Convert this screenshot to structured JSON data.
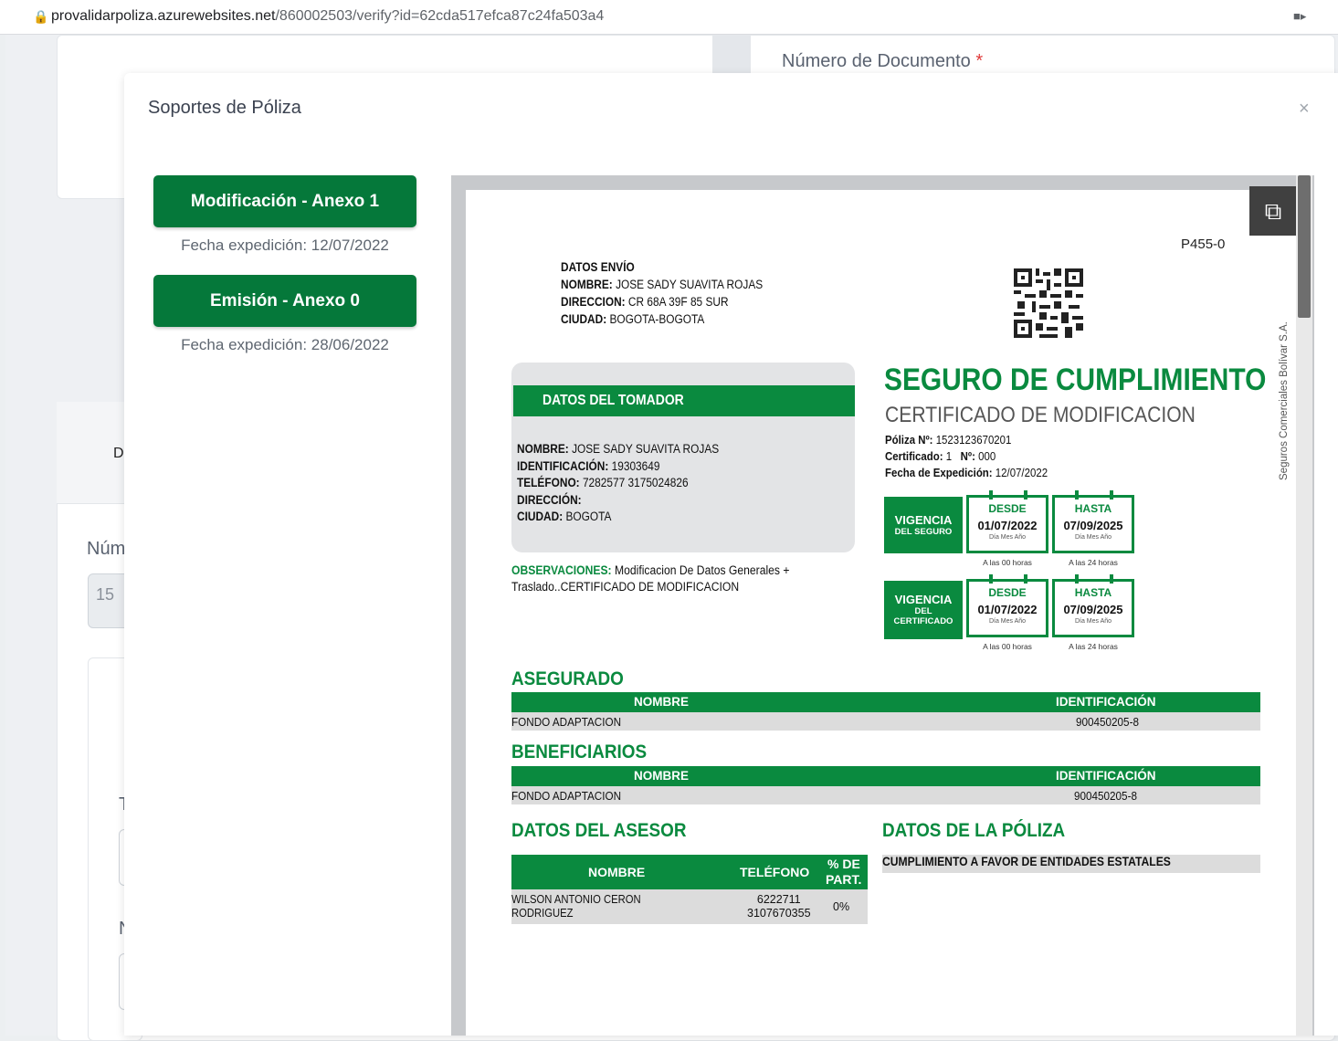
{
  "browser": {
    "url_host": "provalidarpoliza.azurewebsites.net",
    "url_path": "/860002503/verify?id=62cda517efca87c24fa503a4"
  },
  "background": {
    "label_numero_documento": "Número de Documento",
    "required_mark": "*",
    "tab_partial": "D",
    "label_partial_num": "Núm",
    "input_partial_value": "15",
    "label_partial_t": "T",
    "label_partial_n": "N"
  },
  "modal": {
    "title": "Soportes de Póliza",
    "close_label": "×",
    "documents": [
      {
        "label": "Modificación - Anexo 1",
        "date": "Fecha expedición: 12/07/2022"
      },
      {
        "label": "Emisión - Anexo 0",
        "date": "Fecha expedición: 28/06/2022"
      }
    ]
  },
  "document": {
    "code": "P455-0",
    "envio": {
      "title": "DATOS ENVÍO",
      "nombre_label": "NOMBRE:",
      "nombre": "JOSE SADY SUAVITA ROJAS",
      "direccion_label": "DIRECCION:",
      "direccion": "CR 68A 39F 85 SUR",
      "ciudad_label": "CIUDAD:",
      "ciudad": "BOGOTA-BOGOTA"
    },
    "vertical_text": "Seguros Comerciales Bolívar S.A.",
    "tomador": {
      "header": "DATOS DEL TOMADOR",
      "nombre_label": "NOMBRE:",
      "nombre": "JOSE SADY SUAVITA ROJAS",
      "id_label": "IDENTIFICACIÓN:",
      "id": "19303649",
      "tel_label": "TELÉFONO:",
      "tel": "7282577 3175024826",
      "dir_label": "DIRECCIÓN:",
      "ciudad_label": "CIUDAD:",
      "ciudad": "BOGOTA"
    },
    "observaciones_label": "OBSERVACIONES:",
    "observaciones": "Modificacion De Datos Generales + Traslado..CERTIFICADO DE MODIFICACION",
    "title": "SEGURO DE CUMPLIMIENTO",
    "subtitle": "CERTIFICADO DE MODIFICACION",
    "poliza_label": "Póliza Nº:",
    "poliza": "1523123670201",
    "certificado_label": "Certificado:",
    "certificado": "1",
    "no_label": "Nº:",
    "no": "000",
    "fecha_exp_label": "Fecha de Expedición:",
    "fecha_exp": "12/07/2022",
    "vigencia_seguro": {
      "l1": "VIGENCIA",
      "l2": "DEL SEGURO",
      "desde": "01/07/2022",
      "hasta": "07/09/2025"
    },
    "vigencia_cert": {
      "l1": "VIGENCIA",
      "l2": "DEL",
      "l3": "CERTIFICADO",
      "desde": "01/07/2022",
      "hasta": "07/09/2025"
    },
    "desde_label": "DESDE",
    "hasta_label": "HASTA",
    "dma_label": "Día Mes Año",
    "hora_desde": "A las 00 horas",
    "hora_hasta": "A las 24 horas",
    "asegurado_title": "ASEGURADO",
    "beneficiarios_title": "BENEFICIARIOS",
    "col_nombre": "NOMBRE",
    "col_identificacion": "IDENTIFICACIÓN",
    "asegurado_nombre": "FONDO ADAPTACION",
    "asegurado_id": "900450205-8",
    "beneficiario_nombre": "FONDO ADAPTACION",
    "beneficiario_id": "900450205-8",
    "asesor_title": "DATOS DEL ASESOR",
    "asesor_col_nombre": "NOMBRE",
    "asesor_col_tel": "TELÉFONO",
    "asesor_col_part_1": "% DE",
    "asesor_col_part_2": "PART.",
    "asesor_nombre_1": "WILSON ANTONIO CERON",
    "asesor_nombre_2": "RODRIGUEZ",
    "asesor_tel_1": "6222711",
    "asesor_tel_2": "3107670355",
    "asesor_part": "0%",
    "poliza_title": "DATOS DE LA PÓLIZA",
    "poliza_desc": "CUMPLIMIENTO A FAVOR DE ENTIDADES ESTATALES"
  }
}
